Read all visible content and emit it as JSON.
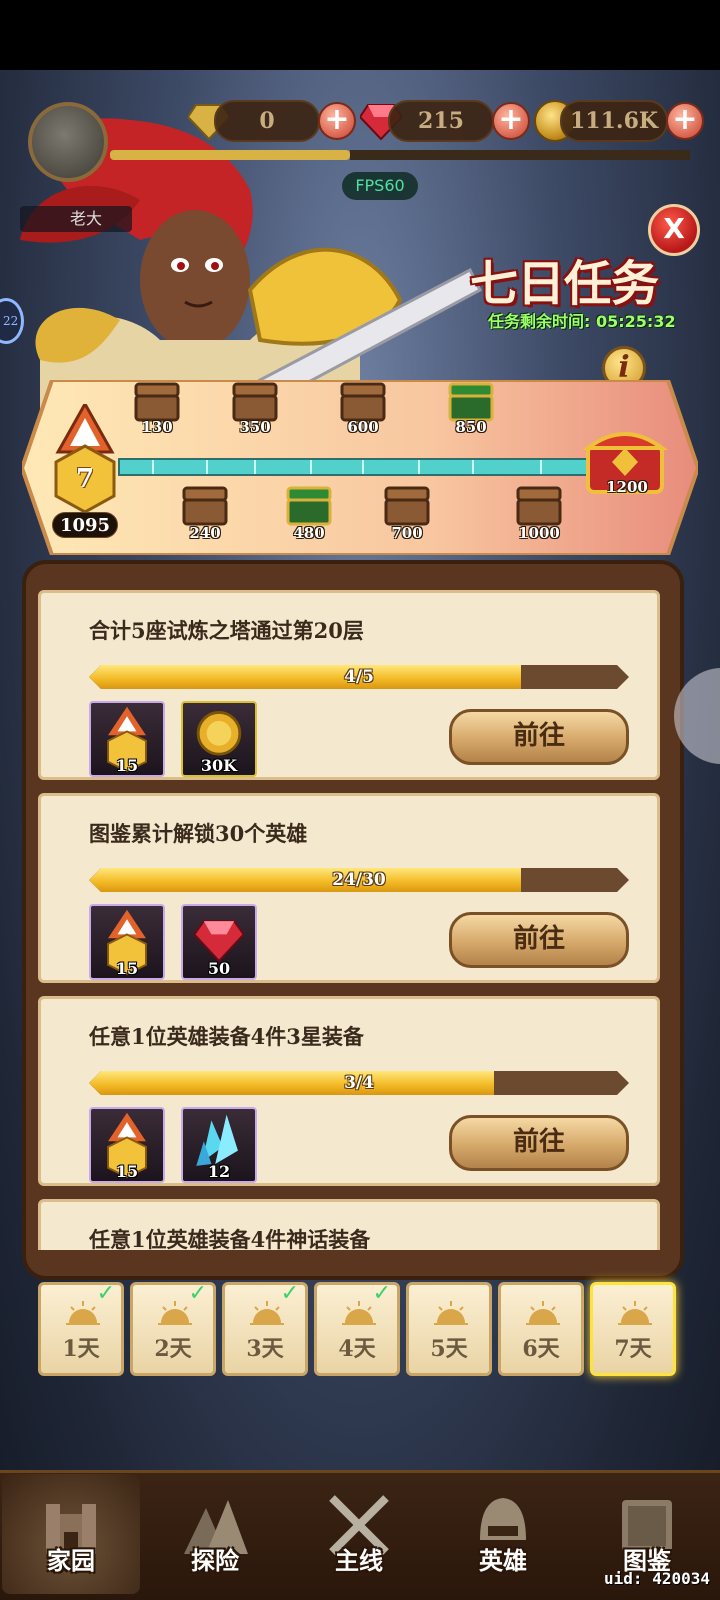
{
  "resources": {
    "green_gem": "0",
    "red_gem": "215",
    "gold": "111.6K"
  },
  "fps": "FPS60",
  "player_name": "老大",
  "left_badge": "22",
  "event": {
    "title": "七日任务",
    "timer_label": "任务剩余时间:",
    "timer_value": "05:25:32"
  },
  "progress": {
    "level": "7",
    "score": "1095",
    "max_points": 1200,
    "current_points": 1095,
    "top_chests": [
      "130",
      "350",
      "600",
      "850"
    ],
    "bottom_chests": [
      "240",
      "480",
      "700",
      "1000"
    ],
    "final_chest": "1200"
  },
  "tasks": [
    {
      "title": "合计5座试炼之塔通过第20层",
      "progress_text": "4/5",
      "progress": 0.8,
      "rewards": [
        {
          "icon": "medal-icon",
          "count": "15"
        },
        {
          "icon": "gold-coin-icon",
          "count": "30K"
        }
      ],
      "button": "前往"
    },
    {
      "title": "图鉴累计解锁30个英雄",
      "progress_text": "24/30",
      "progress": 0.8,
      "rewards": [
        {
          "icon": "medal-icon",
          "count": "15"
        },
        {
          "icon": "red-gem-icon",
          "count": "50"
        }
      ],
      "button": "前往"
    },
    {
      "title": "任意1位英雄装备4件3星装备",
      "progress_text": "3/4",
      "progress": 0.75,
      "rewards": [
        {
          "icon": "medal-icon",
          "count": "15"
        },
        {
          "icon": "blue-crystal-icon",
          "count": "12"
        }
      ],
      "button": "前往"
    },
    {
      "title": "任意1位英雄装备4件神话装备"
    }
  ],
  "days": [
    {
      "label": "1天",
      "done": true
    },
    {
      "label": "2天",
      "done": true
    },
    {
      "label": "3天",
      "done": true
    },
    {
      "label": "4天",
      "done": true
    },
    {
      "label": "5天",
      "done": false
    },
    {
      "label": "6天",
      "done": false
    },
    {
      "label": "7天",
      "done": false,
      "active": true
    }
  ],
  "nav": [
    "家园",
    "探险",
    "主线",
    "英雄",
    "图鉴"
  ],
  "uid": "uid: 420034",
  "colors": {
    "accent_red": "#c7402d",
    "bar_gold": "#f2b823",
    "track_teal": "#52d1cc",
    "timer_green": "#9dff6a"
  }
}
